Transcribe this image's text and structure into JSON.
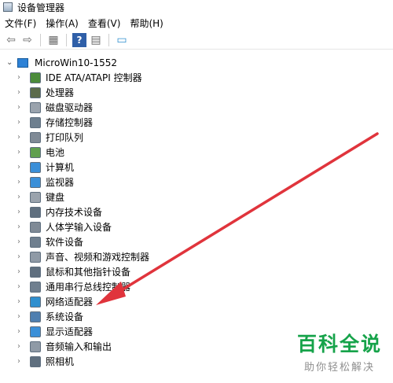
{
  "window": {
    "title": "设备管理器"
  },
  "menu": [
    "文件(F)",
    "操作(A)",
    "查看(V)",
    "帮助(H)"
  ],
  "toolbar": {
    "buttons": [
      {
        "icon": "back-arrow-icon",
        "glyph": "⇦"
      },
      {
        "icon": "forward-arrow-icon",
        "glyph": "⇨"
      },
      {
        "icon": "properties-icon",
        "glyph": "▦"
      },
      {
        "icon": "help-icon",
        "glyph": "?"
      },
      {
        "icon": "view-icon",
        "glyph": "▤"
      },
      {
        "icon": "monitor-scan-icon",
        "glyph": "▭"
      }
    ]
  },
  "tree": {
    "root": "MicroWin10-1552",
    "items": [
      {
        "label": "IDE ATA/ATAPI 控制器",
        "icon": "ide-controller-icon",
        "color": "#4b8b3b"
      },
      {
        "label": "处理器",
        "icon": "processor-icon",
        "color": "#5b6b4b"
      },
      {
        "label": "磁盘驱动器",
        "icon": "disk-drive-icon",
        "color": "#9aa3ad"
      },
      {
        "label": "存储控制器",
        "icon": "storage-controller-icon",
        "color": "#6d7f8f"
      },
      {
        "label": "打印队列",
        "icon": "printer-icon",
        "color": "#7f8a96"
      },
      {
        "label": "电池",
        "icon": "battery-icon",
        "color": "#5f9f4f"
      },
      {
        "label": "计算机",
        "icon": "computer-icon",
        "color": "#3a8fd8"
      },
      {
        "label": "监视器",
        "icon": "monitor-icon",
        "color": "#3a8fd8"
      },
      {
        "label": "键盘",
        "icon": "keyboard-icon",
        "color": "#9aa3ad"
      },
      {
        "label": "内存技术设备",
        "icon": "memory-device-icon",
        "color": "#5f6f7f"
      },
      {
        "label": "人体学输入设备",
        "icon": "hid-icon",
        "color": "#7f8a96"
      },
      {
        "label": "软件设备",
        "icon": "software-device-icon",
        "color": "#6f7f8f"
      },
      {
        "label": "声音、视频和游戏控制器",
        "icon": "sound-icon",
        "color": "#8f9aa6"
      },
      {
        "label": "鼠标和其他指针设备",
        "icon": "mouse-icon",
        "color": "#5f6f7f"
      },
      {
        "label": "通用串行总线控制器",
        "icon": "usb-icon",
        "color": "#6f7f8f"
      },
      {
        "label": "网络适配器",
        "icon": "network-adapter-icon",
        "color": "#2f8fcf"
      },
      {
        "label": "系统设备",
        "icon": "system-device-icon",
        "color": "#4f7fb0"
      },
      {
        "label": "显示适配器",
        "icon": "display-adapter-icon",
        "color": "#3a8fd8"
      },
      {
        "label": "音频输入和输出",
        "icon": "audio-io-icon",
        "color": "#8f9aa6"
      },
      {
        "label": "照相机",
        "icon": "camera-icon",
        "color": "#5f6f7f"
      }
    ]
  },
  "annotation": {
    "color": "#e0343c"
  },
  "watermark": {
    "main": "百科全说",
    "sub": "助你轻松解决",
    "color": "#16a34a"
  }
}
